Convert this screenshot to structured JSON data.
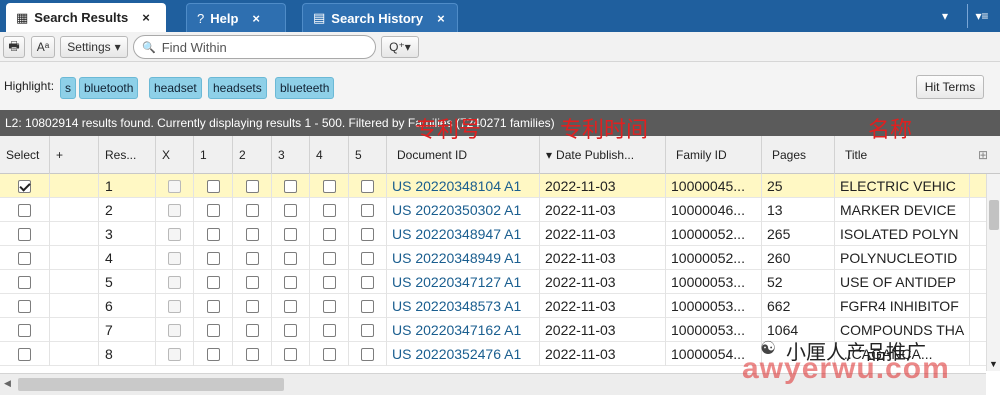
{
  "tabs": [
    {
      "icon": "search-results-icon",
      "icon_glyph": "▦",
      "label": "Search Results",
      "close": "×",
      "active": true
    },
    {
      "icon": "help-icon",
      "icon_glyph": "?",
      "label": "Help",
      "close": "×",
      "active": false
    },
    {
      "icon": "search-history-icon",
      "icon_glyph": "▤",
      "label": "Search History",
      "close": "×",
      "active": false
    }
  ],
  "tabbar_controls": {
    "dropdown": "▾",
    "menu": "▾≡"
  },
  "toolbar": {
    "print_glyph": "🖶",
    "font_size_glyph": "Aᵃ",
    "settings_label": "Settings",
    "settings_caret": "▾",
    "search_placeholder": "Find Within",
    "search_glyph": "🔍",
    "query_options_glyph": "Q⁺▾"
  },
  "highlight": {
    "label": "Highlight:",
    "terms": [
      "s",
      "bluetooth",
      "headset",
      "headsets",
      "blueteeth"
    ],
    "hit_terms_button": "Hit Terms"
  },
  "status": {
    "text": "L2: 10802914 results found. Currently displaying results 1 - 500. Filtered by Families (7240271 families)"
  },
  "annotations": {
    "patent_number": "专利号",
    "patent_date": "专利时间",
    "title": "名称"
  },
  "columns": {
    "select": "Select",
    "plus": "+",
    "result": "Res...",
    "x": "X",
    "c1": "1",
    "c2": "2",
    "c3": "3",
    "c4": "4",
    "c5": "5",
    "document_id": "Document ID",
    "date_published": "Date Publish...",
    "date_sort_indicator": "▾",
    "family_id": "Family ID",
    "pages": "Pages",
    "title": "Title",
    "expand_glyph": "⊞"
  },
  "rows": [
    {
      "selected": true,
      "num": "1",
      "doc_id": "US 20220348104 A1",
      "date": "2022-11-03",
      "family": "10000045...",
      "pages": "25",
      "title": "ELECTRIC VEHIC"
    },
    {
      "selected": false,
      "num": "2",
      "doc_id": "US 20220350302 A1",
      "date": "2022-11-03",
      "family": "10000046...",
      "pages": "13",
      "title": "MARKER DEVICE"
    },
    {
      "selected": false,
      "num": "3",
      "doc_id": "US 20220348947 A1",
      "date": "2022-11-03",
      "family": "10000052...",
      "pages": "265",
      "title": "ISOLATED POLYN"
    },
    {
      "selected": false,
      "num": "4",
      "doc_id": "US 20220348949 A1",
      "date": "2022-11-03",
      "family": "10000052...",
      "pages": "260",
      "title": "POLYNUCLEOTID"
    },
    {
      "selected": false,
      "num": "5",
      "doc_id": "US 20220347127 A1",
      "date": "2022-11-03",
      "family": "10000053...",
      "pages": "52",
      "title": "USE OF ANTIDEP"
    },
    {
      "selected": false,
      "num": "6",
      "doc_id": "US 20220348573 A1",
      "date": "2022-11-03",
      "family": "10000053...",
      "pages": "662",
      "title": "FGFR4 INHIBITOF"
    },
    {
      "selected": false,
      "num": "7",
      "doc_id": "US 20220347162 A1",
      "date": "2022-11-03",
      "family": "10000053...",
      "pages": "1064",
      "title": "COMPOUNDS THA"
    },
    {
      "selected": false,
      "num": "8",
      "doc_id": "US 20220352476 A1",
      "date": "2022-11-03",
      "family": "10000054...",
      "pages": "",
      "title": "...CAGANCA..."
    }
  ],
  "watermark": {
    "wechat_text": "小厘人产品推广",
    "site_text": "awyerwu.com",
    "glyph": "☯"
  },
  "scroll": {
    "left_arrow": "◀",
    "down_arrow": "▼"
  }
}
